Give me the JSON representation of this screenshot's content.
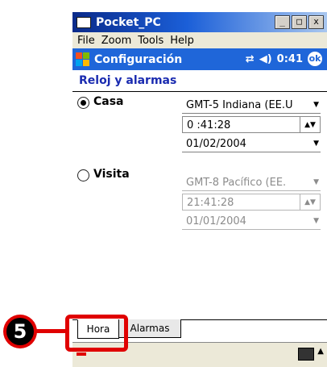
{
  "window": {
    "title": "Pocket_PC",
    "buttons": [
      "_",
      "□",
      "x"
    ]
  },
  "menu": [
    "File",
    "Zoom",
    "Tools",
    "Help"
  ],
  "header": {
    "title": "Configuración",
    "clock": "0:41",
    "ok_label": "ok"
  },
  "section_title": "Reloj y alarmas",
  "home": {
    "label": "Casa",
    "selected": true,
    "timezone": "GMT-5 Indiana (EE.U",
    "time": "0 :41:28",
    "date": "01/02/2004"
  },
  "visiting": {
    "label": "Visita",
    "selected": false,
    "timezone": "GMT-8 Pacífico (EE.",
    "time": "21:41:28",
    "date": "01/01/2004"
  },
  "tabs": [
    "Hora",
    "Alarmas"
  ],
  "callout": {
    "number": "5"
  },
  "colors": {
    "accent_blue": "#1f66d9",
    "highlight_red": "#e00000"
  }
}
